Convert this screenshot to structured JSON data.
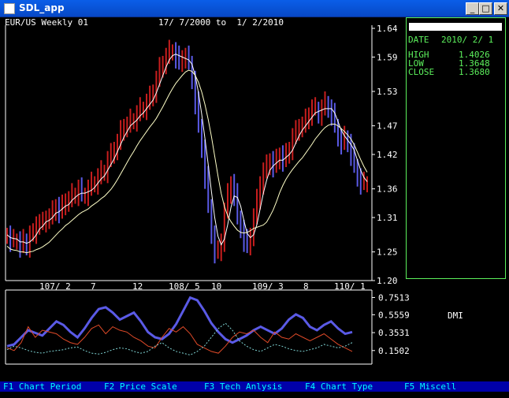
{
  "window": {
    "title": "SDL_app",
    "buttons": {
      "minimize": "_",
      "maximize": "□",
      "close": "✕"
    }
  },
  "header": {
    "instrument": "EUR/US Weekly 01",
    "range": "17/ 7/2000 to  1/ 2/2010"
  },
  "info_panel": {
    "date_label": "DATE",
    "date_value": "2010/ 2/ 1",
    "high_label": "HIGH",
    "high_value": "1.4026",
    "low_label": "LOW",
    "low_value": "1.3648",
    "close_label": "CLOSE",
    "close_value": "1.3680"
  },
  "indicator_label": "DMI",
  "function_keys": [
    "F1 Chart Period",
    "F2 Price Scale",
    "F3 Tech Anlysis",
    "F4 Chart Type",
    "F5 Miscell"
  ],
  "colors": {
    "up_bar": "#c81e1e",
    "down_bar": "#5a5ae6",
    "ma_short": "#ffffff",
    "ma_long": "#ffffc8",
    "dmi_plus": "#5a5ae6",
    "dmi_minus": "#e04a28",
    "dmi_adx": "#7fd4d4",
    "panel_border": "#5cf05c",
    "fkey_bar": "#0000aa",
    "fkey_text": "#00ffff"
  },
  "chart_data": [
    {
      "type": "bar",
      "subtype": "ohlc-price",
      "yticks": [
        "1.64",
        "1.59",
        "1.53",
        "1.47",
        "1.42",
        "1.36",
        "1.31",
        "1.25",
        "1.20"
      ],
      "ylim": [
        1.2,
        1.64
      ],
      "xticks": [
        "107/ 2",
        "7",
        "12",
        "108/ 5",
        "10",
        "109/ 3",
        "8",
        "110/ 1"
      ],
      "series": [],
      "x": [
        0,
        4,
        8,
        12,
        16,
        20,
        24,
        28,
        32,
        36,
        40,
        44,
        48,
        52,
        56,
        60,
        64,
        68,
        72,
        76,
        80,
        84,
        88,
        92,
        96,
        100,
        104,
        108,
        112,
        116,
        120,
        124,
        128,
        132,
        136,
        140,
        144,
        148,
        152,
        156,
        160,
        164,
        168,
        172,
        176,
        180,
        184,
        188,
        192,
        196,
        200,
        204,
        208,
        212,
        216,
        220,
        224,
        228,
        232,
        236,
        240,
        244,
        248,
        252,
        256,
        260,
        264,
        268,
        272,
        276,
        280,
        284,
        288,
        292,
        296,
        300,
        304,
        308,
        312,
        316,
        320,
        324,
        328,
        332,
        336,
        340,
        344,
        348,
        352,
        356,
        360,
        364,
        368,
        372,
        376,
        380,
        384,
        388,
        392,
        396,
        400,
        404,
        408,
        412,
        416,
        420,
        424,
        428,
        432,
        436,
        440,
        444
      ],
      "close": [
        1.28,
        1.27,
        1.27,
        1.27,
        1.26,
        1.27,
        1.26,
        1.28,
        1.28,
        1.3,
        1.3,
        1.3,
        1.31,
        1.31,
        1.32,
        1.33,
        1.32,
        1.33,
        1.34,
        1.34,
        1.35,
        1.35,
        1.36,
        1.35,
        1.35,
        1.36,
        1.37,
        1.37,
        1.38,
        1.39,
        1.39,
        1.41,
        1.42,
        1.43,
        1.44,
        1.46,
        1.47,
        1.47,
        1.48,
        1.48,
        1.49,
        1.5,
        1.5,
        1.51,
        1.52,
        1.53,
        1.55,
        1.57,
        1.58,
        1.59,
        1.6,
        1.6,
        1.59,
        1.58,
        1.59,
        1.59,
        1.58,
        1.55,
        1.51,
        1.47,
        1.43,
        1.38,
        1.33,
        1.28,
        1.25,
        1.25,
        1.27,
        1.32,
        1.35,
        1.37,
        1.35,
        1.31,
        1.29,
        1.27,
        1.26,
        1.28,
        1.31,
        1.34,
        1.37,
        1.39,
        1.4,
        1.41,
        1.4,
        1.41,
        1.42,
        1.41,
        1.42,
        1.43,
        1.45,
        1.46,
        1.47,
        1.47,
        1.48,
        1.49,
        1.5,
        1.5,
        1.49,
        1.5,
        1.51,
        1.5,
        1.49,
        1.47,
        1.45,
        1.44,
        1.45,
        1.44,
        1.42,
        1.4,
        1.38,
        1.37,
        1.37,
        1.37
      ]
    },
    {
      "type": "line",
      "subtype": "dmi-indicator",
      "yticks": [
        "0.7513",
        "0.5559",
        "0.3531",
        "0.1502"
      ],
      "series": [
        {
          "values": [
            0.2,
            0.22,
            0.3,
            0.38,
            0.35,
            0.32,
            0.4,
            0.48,
            0.44,
            0.36,
            0.3,
            0.4,
            0.52,
            0.62,
            0.64,
            0.58,
            0.5,
            0.54,
            0.58,
            0.48,
            0.36,
            0.3,
            0.28,
            0.34,
            0.45,
            0.6,
            0.75,
            0.72,
            0.6,
            0.46,
            0.36,
            0.28,
            0.24,
            0.28,
            0.32,
            0.38,
            0.42,
            0.38,
            0.34,
            0.4,
            0.5,
            0.56,
            0.52,
            0.42,
            0.38,
            0.44,
            0.48,
            0.4,
            0.34,
            0.36
          ]
        },
        {
          "values": [
            0.18,
            0.15,
            0.24,
            0.42,
            0.3,
            0.38,
            0.36,
            0.34,
            0.28,
            0.24,
            0.22,
            0.3,
            0.4,
            0.44,
            0.34,
            0.42,
            0.38,
            0.36,
            0.3,
            0.26,
            0.2,
            0.18,
            0.3,
            0.4,
            0.36,
            0.42,
            0.34,
            0.22,
            0.18,
            0.14,
            0.12,
            0.2,
            0.3,
            0.36,
            0.34,
            0.38,
            0.3,
            0.24,
            0.36,
            0.3,
            0.28,
            0.34,
            0.3,
            0.26,
            0.3,
            0.34,
            0.28,
            0.22,
            0.18,
            0.14
          ]
        },
        {
          "values": [
            0.16,
            0.2,
            0.18,
            0.15,
            0.13,
            0.12,
            0.14,
            0.15,
            0.16,
            0.18,
            0.19,
            0.15,
            0.12,
            0.11,
            0.13,
            0.16,
            0.18,
            0.17,
            0.14,
            0.12,
            0.14,
            0.2,
            0.24,
            0.18,
            0.14,
            0.12,
            0.1,
            0.14,
            0.2,
            0.3,
            0.4,
            0.46,
            0.38,
            0.26,
            0.2,
            0.16,
            0.14,
            0.18,
            0.22,
            0.2,
            0.17,
            0.15,
            0.14,
            0.16,
            0.18,
            0.22,
            0.2,
            0.18,
            0.2,
            0.24
          ]
        }
      ]
    }
  ]
}
